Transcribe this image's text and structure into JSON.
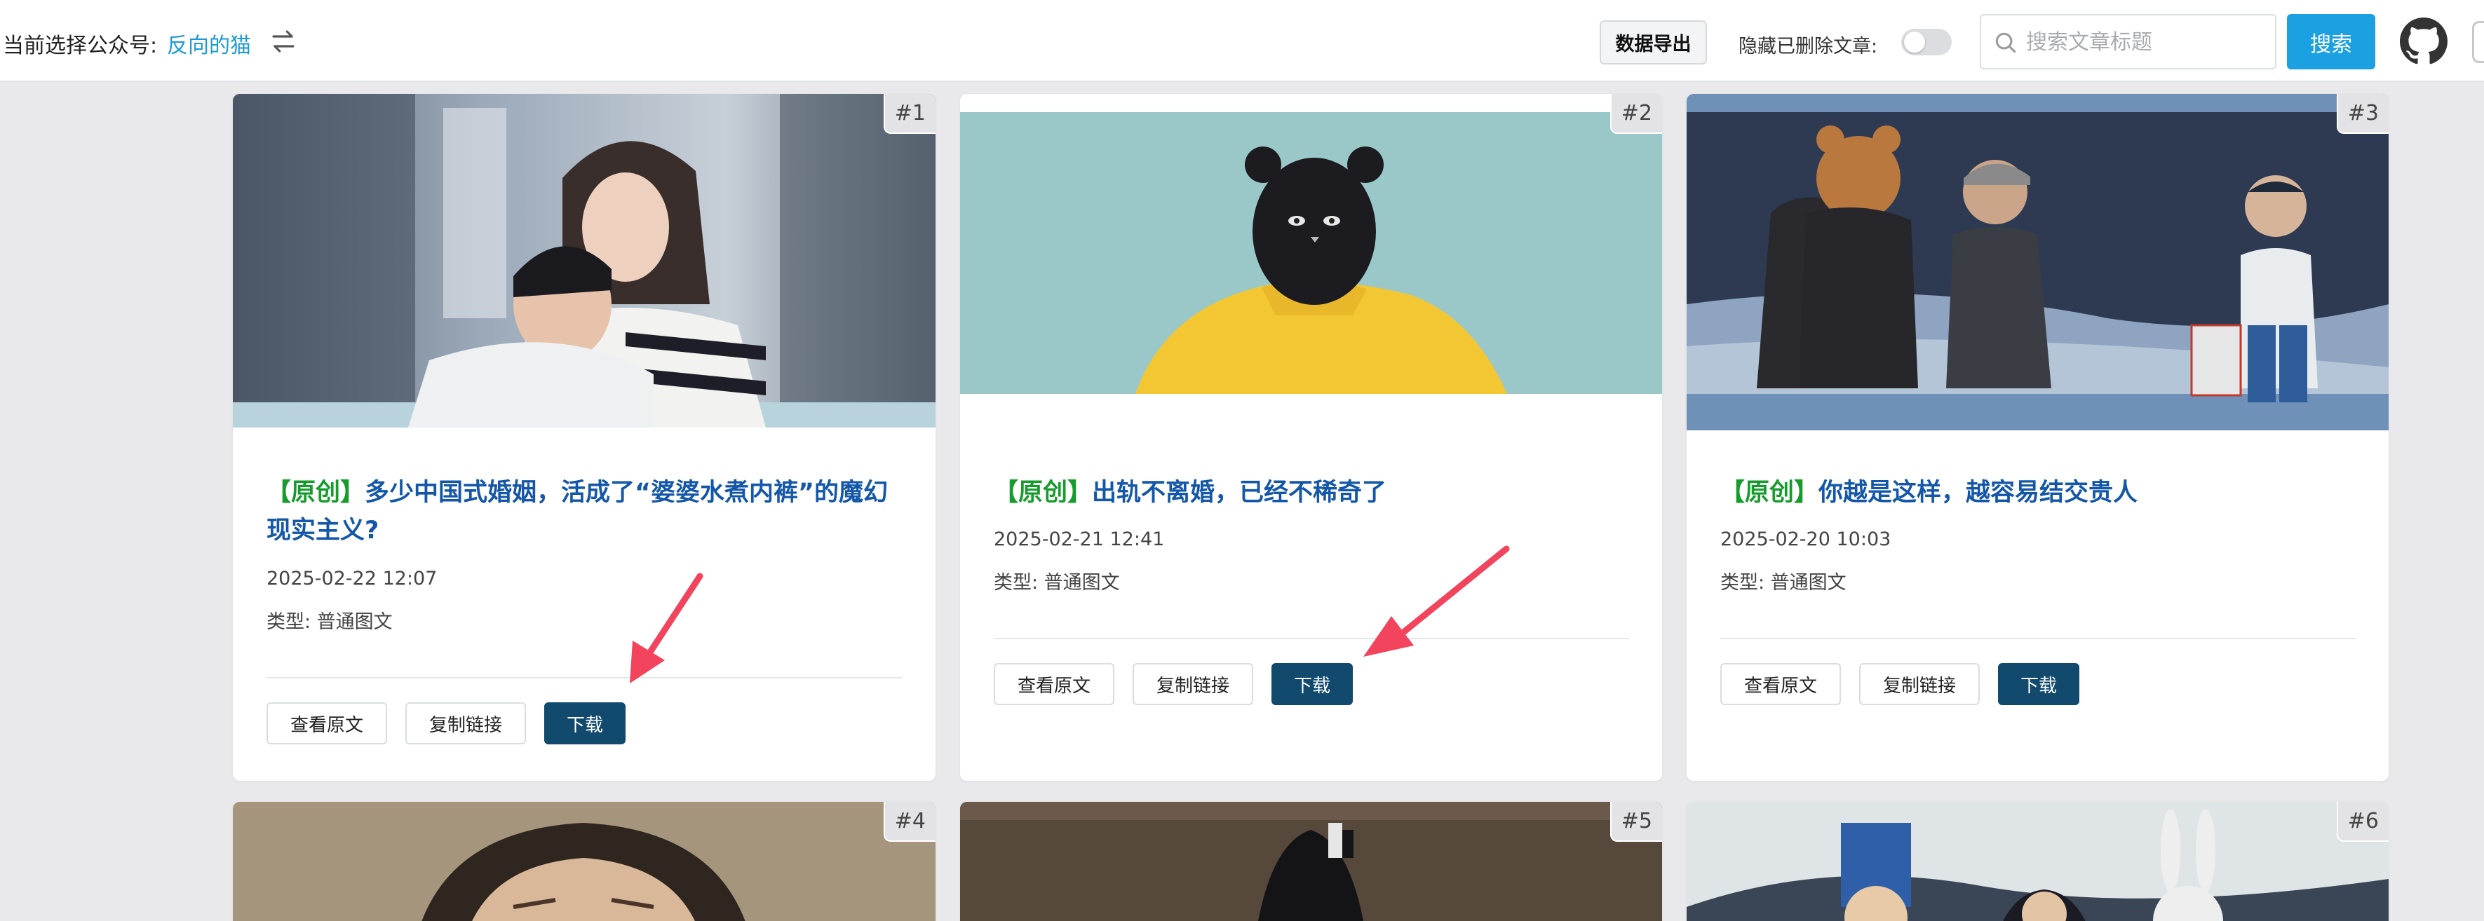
{
  "header": {
    "account_label": "当前选择公众号:",
    "account_name": "反向的猫",
    "export_label": "数据导出",
    "hide_deleted_label": "隐藏已删除文章:",
    "search_placeholder": "搜索文章标题",
    "search_button": "搜索",
    "hide_deleted_on": false
  },
  "cards": [
    {
      "index": "#1",
      "tag": "【原创】",
      "title": "多少中国式婚姻，活成了“婆婆水煮内裤”的魔幻现实主义?",
      "date": "2025-02-22 12:07",
      "type": "类型: 普通图文",
      "view_label": "查看原文",
      "copy_label": "复制链接",
      "download_label": "下载"
    },
    {
      "index": "#2",
      "tag": "【原创】",
      "title": "出轨不离婚，已经不稀奇了",
      "date": "2025-02-21 12:41",
      "type": "类型: 普通图文",
      "view_label": "查看原文",
      "copy_label": "复制链接",
      "download_label": "下载"
    },
    {
      "index": "#3",
      "tag": "【原创】",
      "title": "你越是这样，越容易结交贵人",
      "date": "2025-02-20 10:03",
      "type": "类型: 普通图文",
      "view_label": "查看原文",
      "copy_label": "复制链接",
      "download_label": "下载"
    },
    {
      "index": "#4"
    },
    {
      "index": "#5"
    },
    {
      "index": "#6"
    }
  ],
  "colors": {
    "accent": "#1ba1e2",
    "download_button": "#124a6e",
    "title": "#1457a8",
    "original_tag": "#169c2c",
    "annotation_arrow": "#f2445c"
  }
}
